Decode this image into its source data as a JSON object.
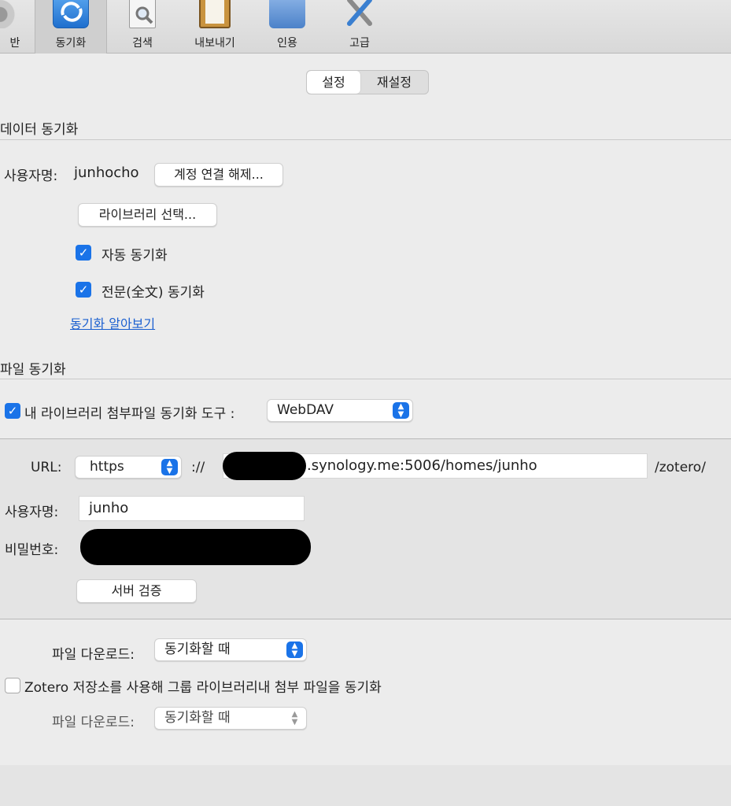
{
  "toolbar": {
    "items": [
      {
        "label": "반",
        "icon": "gear-icon"
      },
      {
        "label": "동기화",
        "icon": "sync-icon"
      },
      {
        "label": "검색",
        "icon": "search-document-icon"
      },
      {
        "label": "내보내기",
        "icon": "clipboard-icon"
      },
      {
        "label": "인용",
        "icon": "folder-icon"
      },
      {
        "label": "고급",
        "icon": "tools-icon"
      }
    ],
    "active": "동기화"
  },
  "tabs": {
    "settings": "설정",
    "reset": "재설정"
  },
  "data_sync": {
    "title": "데이터 동기화",
    "username_label": "사용자명:",
    "username_value": "junhocho",
    "unlink_button": "계정 연결 해제...",
    "choose_library_button": "라이브러리 선택...",
    "auto_sync_label": "자동 동기화",
    "auto_sync_checked": true,
    "fulltext_sync_label": "전문(全文) 동기화",
    "fulltext_sync_checked": true,
    "learn_more_link": "동기화 알아보기"
  },
  "file_sync": {
    "title": "파일 동기화",
    "my_library_label": "내 라이브러리 첨부파일 동기화 도구 :",
    "my_library_checked": true,
    "tool_select_value": "WebDAV",
    "url_label": "URL:",
    "protocol_value": "https",
    "scheme_sep": "://",
    "url_value": ".synology.me:5006/homes/junho",
    "url_suffix": "/zotero/",
    "username_label": "사용자명:",
    "username_value": "junho",
    "password_label": "비밀번호:",
    "verify_button": "서버 검증",
    "download_label_1": "파일 다운로드:",
    "download_value_1": "동기화할 때",
    "group_storage_label": "Zotero 저장소를 사용해 그룹 라이브러리내 첨부 파일을 동기화",
    "group_storage_checked": false,
    "download_label_2": "파일 다운로드:",
    "download_value_2": "동기화할 때"
  },
  "colors": {
    "accent": "#1a73e8",
    "link": "#1a5fd0",
    "background": "#ececec"
  }
}
